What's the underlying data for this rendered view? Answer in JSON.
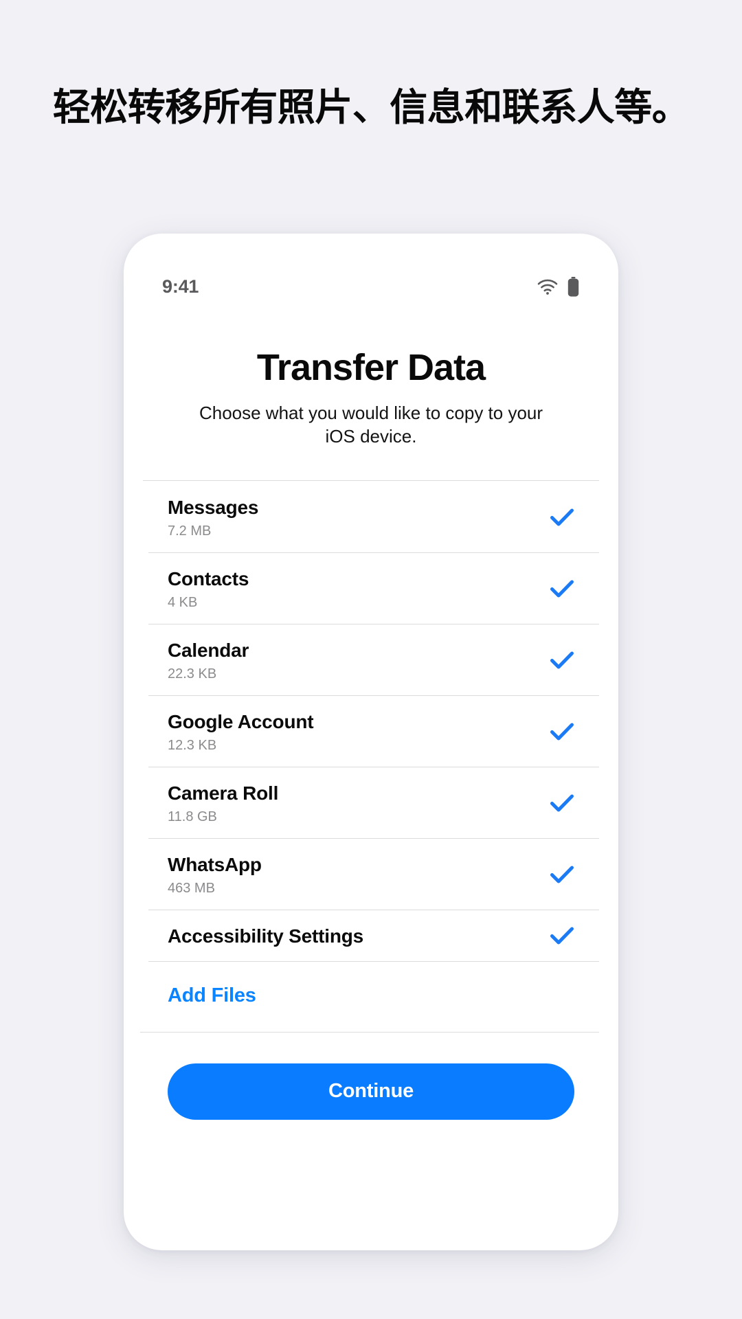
{
  "page": {
    "background_color": "#f1f1f6",
    "headline": "轻松转移所有照片、信息和联系人等。"
  },
  "phone": {
    "statusbar": {
      "time": "9:41",
      "wifi_icon": "wifi-icon",
      "battery_icon": "battery-icon"
    },
    "screen": {
      "title": "Transfer Data",
      "subtitle": "Choose what you would like to copy to your iOS device.",
      "accent_color": "#0a7cff",
      "check_color": "#1a7bf5",
      "items": [
        {
          "label": "Messages",
          "size": "7.2 MB",
          "checked": true,
          "check_icon": "check-icon"
        },
        {
          "label": "Contacts",
          "size": "4 KB",
          "checked": true,
          "check_icon": "check-icon"
        },
        {
          "label": "Calendar",
          "size": "22.3 KB",
          "checked": true,
          "check_icon": "check-icon"
        },
        {
          "label": "Google Account",
          "size": "12.3 KB",
          "checked": true,
          "check_icon": "check-icon"
        },
        {
          "label": "Camera Roll",
          "size": "11.8 GB",
          "checked": true,
          "check_icon": "check-icon"
        },
        {
          "label": "WhatsApp",
          "size": "463 MB",
          "checked": true,
          "check_icon": "check-icon"
        },
        {
          "label": "Accessibility Settings",
          "size": "",
          "checked": true,
          "check_icon": "check-icon"
        }
      ],
      "add_files_label": "Add Files",
      "continue_label": "Continue"
    }
  }
}
